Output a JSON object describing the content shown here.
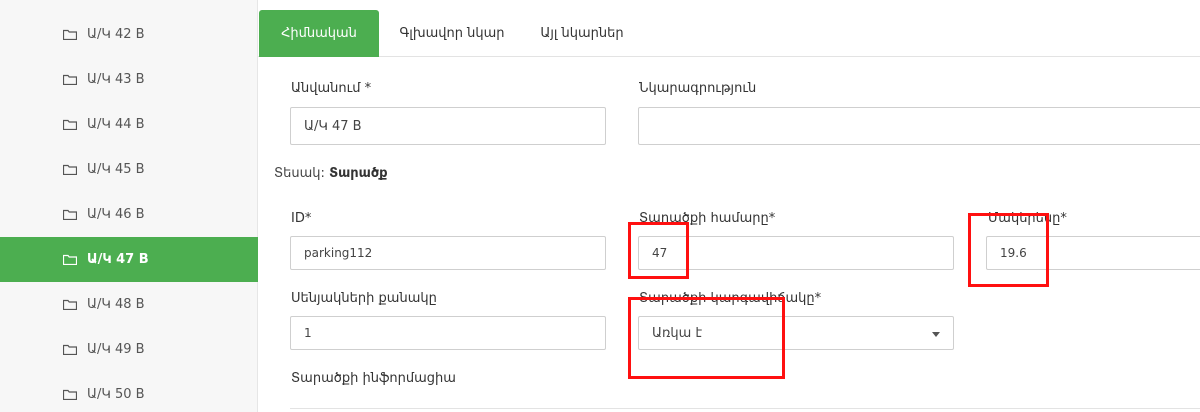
{
  "sidebar": {
    "items": [
      {
        "label": "Ա/Կ 42 B",
        "active": false
      },
      {
        "label": "Ա/Կ 43 B",
        "active": false
      },
      {
        "label": "Ա/Կ 44 B",
        "active": false
      },
      {
        "label": "Ա/Կ 45 B",
        "active": false
      },
      {
        "label": "Ա/Կ 46 B",
        "active": false
      },
      {
        "label": "Ա/Կ 47 B",
        "active": true
      },
      {
        "label": "Ա/Կ 48 B",
        "active": false
      },
      {
        "label": "Ա/Կ 49 B",
        "active": false
      },
      {
        "label": "Ա/Կ 50 B",
        "active": false
      }
    ]
  },
  "tabs": [
    {
      "label": "Հիմնական",
      "active": true
    },
    {
      "label": "Գլխավոր նկար",
      "active": false
    },
    {
      "label": "Այլ նկարներ",
      "active": false
    }
  ],
  "form": {
    "name_label": "Անվանում *",
    "name_value": "Ա/Կ 47 B",
    "description_label": "Նկարագրություն",
    "description_value": "",
    "type_prefix": "Տեսակ:",
    "type_value": "Տարածք",
    "id_label": "ID*",
    "id_value": "parking112",
    "space_number_label": "Տարածքի համարը*",
    "space_number_value": "47",
    "area_label": "Մակերեսը*",
    "area_value": "19.6",
    "rooms_label": "Սենյակների քանակը",
    "rooms_value": "1",
    "status_label": "Տարածքի կարգավիճակը*",
    "status_value": "Առկա է",
    "info_label": "Տարածքի ինֆորմացիա"
  },
  "colors": {
    "accent": "#4cae50",
    "highlight": "#ff1010"
  }
}
